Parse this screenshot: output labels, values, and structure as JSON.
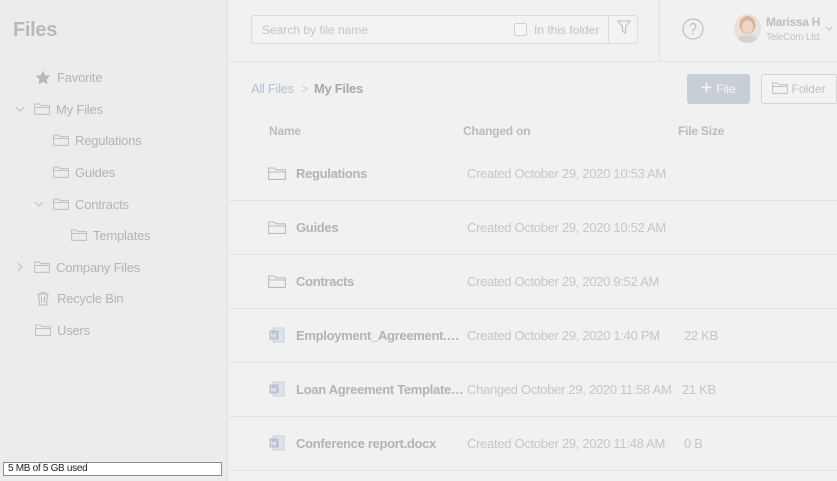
{
  "sidebar": {
    "title": "Files",
    "items": [
      {
        "label": "Favorite",
        "icon": "star-icon",
        "chevron": ""
      },
      {
        "label": "My Files",
        "icon": "folder-icon",
        "chevron": "down"
      },
      {
        "label": "Regulations",
        "icon": "folder-icon",
        "chevron": ""
      },
      {
        "label": "Guides",
        "icon": "folder-icon",
        "chevron": ""
      },
      {
        "label": "Contracts",
        "icon": "folder-icon",
        "chevron": "down"
      },
      {
        "label": "Templates",
        "icon": "folder-icon",
        "chevron": ""
      },
      {
        "label": "Company Files",
        "icon": "folder-icon",
        "chevron": "right"
      },
      {
        "label": "Recycle Bin",
        "icon": "trash-icon",
        "chevron": ""
      },
      {
        "label": "Users",
        "icon": "folder-icon",
        "chevron": ""
      }
    ],
    "storage_text": "5 MB of 5 GB used"
  },
  "search": {
    "placeholder": "Search by file name",
    "in_folder_label": "In this folder"
  },
  "user": {
    "name": "Marissa H",
    "org": "TeleCom Ltd."
  },
  "breadcrumb": {
    "root": "All Files",
    "separator": ">",
    "current": "My Files"
  },
  "toolbar": {
    "file_label": "File",
    "folder_label": "Folder"
  },
  "table": {
    "columns": {
      "name": "Name",
      "changed": "Changed on",
      "size": "File Size"
    },
    "rows": [
      {
        "type": "folder",
        "name": "Regulations",
        "date": "Created October 29, 2020 10:53 AM",
        "size": ""
      },
      {
        "type": "folder",
        "name": "Guides",
        "date": "Created October 29, 2020 10:52 AM",
        "size": ""
      },
      {
        "type": "folder",
        "name": "Contracts",
        "date": "Created October 29, 2020 9:52 AM",
        "size": ""
      },
      {
        "type": "word",
        "name": "Employment_Agreement.docx",
        "date": "Created October 29, 2020 1:40 PM",
        "size": "22 KB"
      },
      {
        "type": "word",
        "name": "Loan Agreement Template.docx",
        "date": "Changed October 29, 2020 11:58 AM",
        "size": "21 KB"
      },
      {
        "type": "word",
        "name": "Conference report.docx",
        "date": "Created October 29, 2020 11:48 AM",
        "size": "0 B"
      }
    ]
  },
  "colors": {
    "sidebar_bg": "#ececec",
    "main_bg": "#f1f1f1",
    "accent": "#c8ced6",
    "link": "#b0c2d4"
  }
}
